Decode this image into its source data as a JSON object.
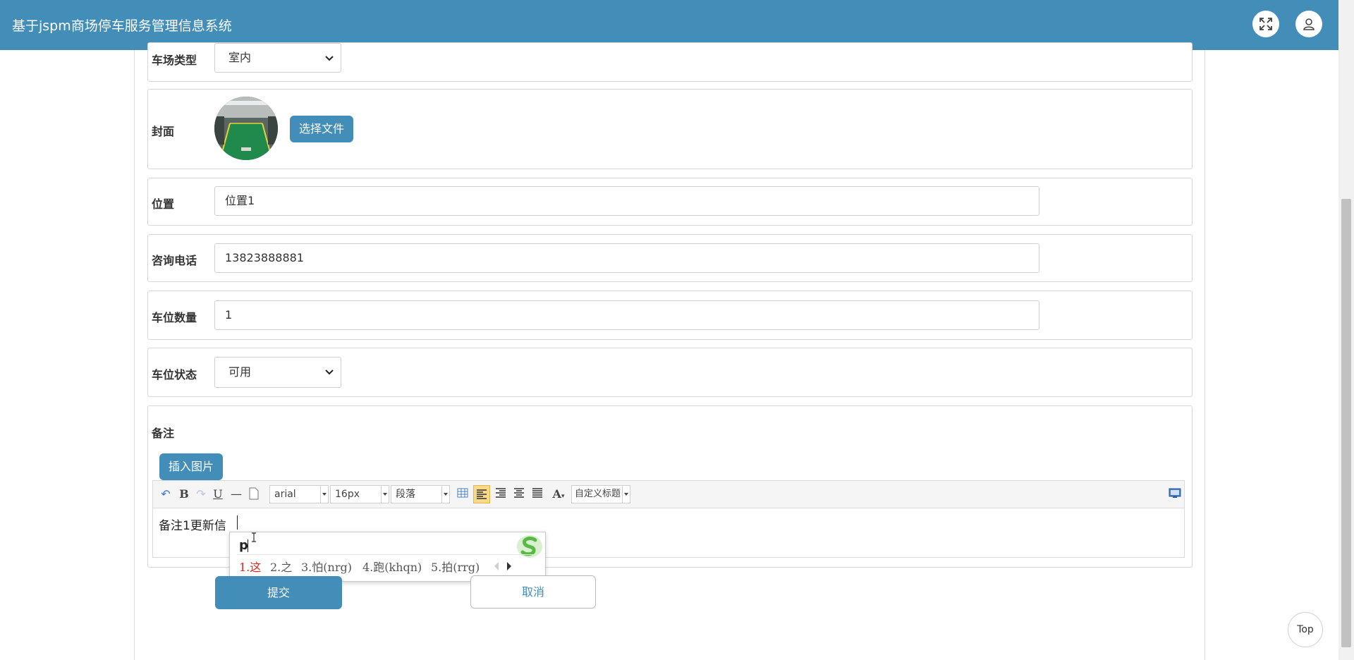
{
  "header": {
    "title": "基于jspm商场停车服务管理信息系统",
    "fullscreen_icon": "expand-icon",
    "user_icon": "user-icon"
  },
  "form": {
    "lot_type": {
      "label": "车场类型",
      "value": "室内"
    },
    "cover": {
      "label": "封面",
      "choose_file": "选择文件"
    },
    "location": {
      "label": "位置",
      "value": "位置1"
    },
    "phone": {
      "label": "咨询电话",
      "value": "13823888881"
    },
    "spaces": {
      "label": "车位数量",
      "value": "1"
    },
    "status": {
      "label": "车位状态",
      "value": "可用"
    },
    "remark": {
      "label": "备注",
      "insert_image": "插入图片",
      "content": "备注1更新信",
      "toolbar": {
        "font_family": "arial",
        "font_size": "16px",
        "paragraph": "段落",
        "custom_heading": "自定义标题"
      }
    },
    "submit": "提交",
    "cancel": "取消"
  },
  "ime": {
    "typed": "p",
    "candidates": [
      "1.这",
      "2.之",
      "3.怕(nrg)",
      "4.跑(khqn)",
      "5.拍(rrg)"
    ],
    "highlight_color": "#e0251b"
  },
  "back_to_top": "Top",
  "colors": {
    "primary": "#438eb9"
  }
}
